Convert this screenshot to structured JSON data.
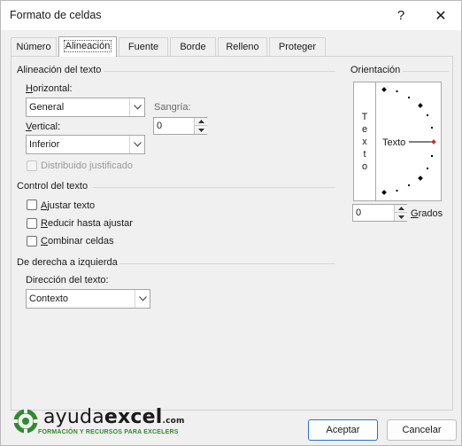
{
  "window": {
    "title": "Formato de celdas",
    "help_glyph": "?",
    "close_glyph": "✕"
  },
  "tabs": [
    {
      "label": "Número",
      "active": false
    },
    {
      "label": "Alineación",
      "active": true
    },
    {
      "label": "Fuente",
      "active": false
    },
    {
      "label": "Borde",
      "active": false
    },
    {
      "label": "Relleno",
      "active": false
    },
    {
      "label": "Proteger",
      "active": false
    }
  ],
  "text_alignment": {
    "group_label": "Alineación del texto",
    "horizontal_label": "Horizontal:",
    "horizontal_value": "General",
    "vertical_label": "Vertical:",
    "vertical_value": "Inferior",
    "indent_label": "Sangría:",
    "indent_value": "0",
    "justify_distributed_label": "Distribuido justificado"
  },
  "text_control": {
    "group_label": "Control del texto",
    "wrap_label": "Ajustar texto",
    "shrink_label": "Reducir hasta ajustar",
    "merge_label": "Combinar celdas"
  },
  "rtl": {
    "group_label": "De derecha a izquierda",
    "direction_label": "Dirección del texto:",
    "direction_value": "Contexto"
  },
  "orientation": {
    "group_label": "Orientación",
    "vertical_text": [
      "T",
      "e",
      "x",
      "t",
      "o"
    ],
    "dial_text": "Texto",
    "degrees_value": "0",
    "degrees_label": "Grados"
  },
  "buttons": {
    "ok": "Aceptar",
    "cancel": "Cancelar"
  },
  "logo": {
    "name_light": "ayuda",
    "name_bold": "excel",
    "suffix": ".com",
    "tagline": "FORMACIÓN Y RECURSOS PARA EXCELERS"
  },
  "colors": {
    "accent": "#2a6fc1",
    "brand_green": "#2e8b2e",
    "dial_marker": "#c0392b"
  }
}
